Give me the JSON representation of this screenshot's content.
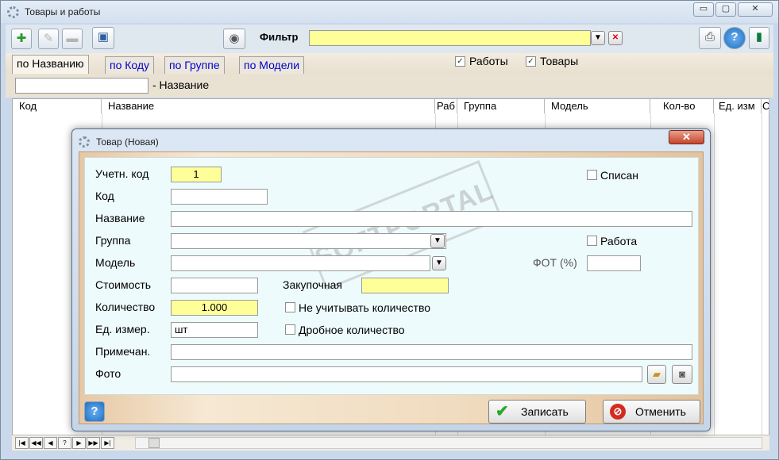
{
  "window": {
    "title": "Товары и работы",
    "controls": [
      "▭",
      "▢",
      "✕"
    ]
  },
  "toolbar": {
    "filter_label": "Фильтр",
    "filter_value": ""
  },
  "tabs": [
    {
      "label": "по Названию"
    },
    {
      "label": "по Коду"
    },
    {
      "label": "по Группе"
    },
    {
      "label": "по Модели"
    }
  ],
  "checks": {
    "works_label": "Работы",
    "works_checked": true,
    "goods_label": "Товары",
    "goods_checked": true
  },
  "search": {
    "value": "",
    "label": "- Название"
  },
  "grid": {
    "columns": [
      "Код",
      "Название",
      "Раб",
      "Группа",
      "Модель",
      "Кол-во",
      "Ед. изм",
      "С"
    ]
  },
  "navbar": {
    "buttons": [
      "|◀",
      "◀◀",
      "◀",
      "?",
      "▶",
      "▶▶",
      "▶|"
    ]
  },
  "dialog": {
    "title": "Товар   (Новая)",
    "close_label": "✕",
    "fields": {
      "acc_code_label": "Учетн. код",
      "acc_code_value": "1",
      "code_label": "Код",
      "code_value": "",
      "name_label": "Название",
      "name_value": "",
      "group_label": "Группа",
      "group_value": "",
      "model_label": "Модель",
      "model_value": "",
      "cost_label": "Стоимость",
      "cost_value": "",
      "purchase_label": "Закупочная",
      "purchase_value": "",
      "qty_label": "Количество",
      "qty_value": "1.000",
      "unit_label": "Ед. измер.",
      "unit_value": "шт",
      "note_label": "Примечан.",
      "note_value": "",
      "photo_label": "Фото",
      "photo_value": "",
      "fot_label": "ФОТ (%)",
      "fot_value": ""
    },
    "checkboxes": {
      "written_off_label": "Списан",
      "written_off_checked": false,
      "work_label": "Работа",
      "work_checked": false,
      "ignore_qty_label": "Не учитывать количество",
      "ignore_qty_checked": false,
      "fraction_qty_label": "Дробное количество",
      "fraction_qty_checked": false
    },
    "buttons": {
      "save_label": "Записать",
      "cancel_label": "Отменить"
    },
    "watermark": "SOFTPORTAL"
  },
  "colors": {
    "filter_bg": "#ffff99",
    "tab_link": "#0000cc",
    "dialog_body": "#eefbfc"
  }
}
